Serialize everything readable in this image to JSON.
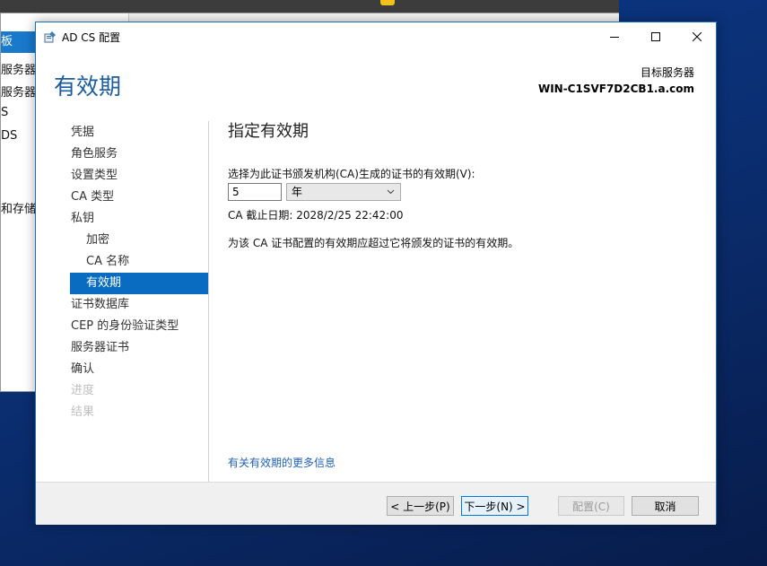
{
  "background_window": {
    "nav_items": [
      "板",
      "服务器",
      "服务器",
      "S",
      "DS",
      "和存储"
    ]
  },
  "dialog": {
    "title": "AD CS 配置",
    "page_title": "有效期",
    "target_server_label": "目标服务器",
    "target_server_name": "WIN-C1SVF7D2CB1.a.com",
    "steps": [
      {
        "label": "凭据",
        "state": "normal",
        "sub": false
      },
      {
        "label": "角色服务",
        "state": "normal",
        "sub": false
      },
      {
        "label": "设置类型",
        "state": "normal",
        "sub": false
      },
      {
        "label": "CA 类型",
        "state": "normal",
        "sub": false
      },
      {
        "label": "私钥",
        "state": "normal",
        "sub": false
      },
      {
        "label": "加密",
        "state": "normal",
        "sub": true
      },
      {
        "label": "CA 名称",
        "state": "normal",
        "sub": true
      },
      {
        "label": "有效期",
        "state": "active",
        "sub": true
      },
      {
        "label": "证书数据库",
        "state": "normal",
        "sub": false
      },
      {
        "label": "CEP 的身份验证类型",
        "state": "normal",
        "sub": false
      },
      {
        "label": "服务器证书",
        "state": "normal",
        "sub": false
      },
      {
        "label": "确认",
        "state": "normal",
        "sub": false
      },
      {
        "label": "进度",
        "state": "disabled",
        "sub": false
      },
      {
        "label": "结果",
        "state": "disabled",
        "sub": false
      }
    ],
    "content": {
      "title": "指定有效期",
      "validity_label": "选择为此证书颁发机构(CA)生成的证书的有效期(V):",
      "validity_value": "5",
      "validity_unit": "年",
      "ca_expiry": "CA 截止日期: 2028/2/25 22:42:00",
      "note": "为该 CA 证书配置的有效期应超过它将颁发的证书的有效期。",
      "more_info_link": "有关有效期的更多信息"
    },
    "buttons": {
      "previous": "< 上一步(P)",
      "next": "下一步(N) >",
      "configure": "配置(C)",
      "cancel": "取消"
    }
  },
  "colors": {
    "accent": "#0a6cc0",
    "title_blue": "#1a5c9e",
    "link": "#1f62b3"
  }
}
